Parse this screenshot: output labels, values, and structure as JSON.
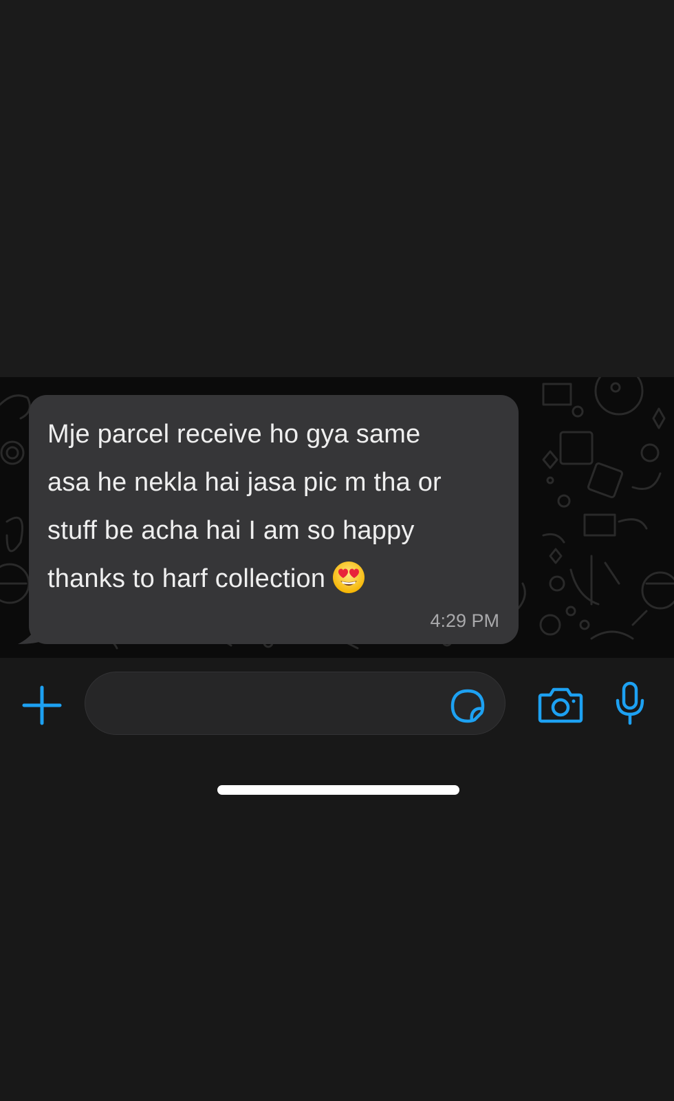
{
  "message": {
    "text": "Mje parcel receive ho gya same\nasa he nekla hai jasa pic m tha or\nstuff be acha hai I am so happy\nthanks to harf collection",
    "emoji": "smiling-face-with-heart-eyes",
    "time": "4:29 PM"
  },
  "composer": {
    "placeholder": ""
  },
  "icons": {
    "plus": "plus-icon",
    "sticker": "sticker-icon",
    "camera": "camera-icon",
    "mic": "microphone-icon"
  },
  "colors": {
    "accent": "#1da1f2",
    "bubble": "#363638",
    "chat_background": "#0b0b0b",
    "bar_background": "#181818"
  }
}
